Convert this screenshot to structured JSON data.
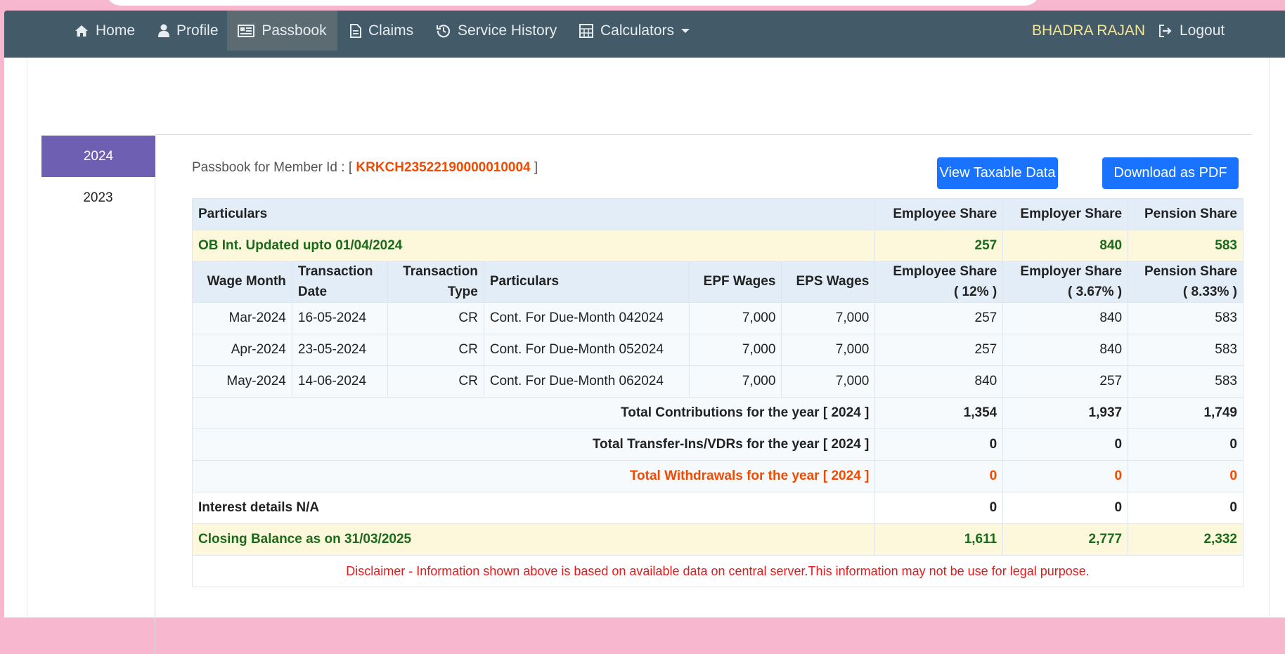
{
  "nav": {
    "home": "Home",
    "profile": "Profile",
    "passbook": "Passbook",
    "claims": "Claims",
    "service_history": "Service History",
    "calculators": "Calculators",
    "user": "BHADRA RAJAN",
    "logout": "Logout"
  },
  "years": [
    "2024",
    "2023"
  ],
  "passbook": {
    "prefix": "Passbook for Member Id : [",
    "member_id": "KRKCH23522190000010004",
    "suffix": "]"
  },
  "buttons": {
    "view_taxable": "View Taxable Data",
    "download_pdf": "Download as PDF"
  },
  "table": {
    "header": {
      "particulars": "Particulars",
      "employee_share": "Employee Share",
      "employer_share": "Employer Share",
      "pension_share": "Pension Share"
    },
    "ob": {
      "label": "OB Int. Updated upto 01/04/2024",
      "employee": "257",
      "employer": "840",
      "pension": "583"
    },
    "columns": {
      "wage_month": "Wage Month",
      "transaction_date": "Transaction Date",
      "transaction_type": "Transaction Type",
      "particulars": "Particulars",
      "epf_wages": "EPF Wages",
      "eps_wages": "EPS Wages",
      "employee_share": "Employee Share",
      "employee_pct": "( 12% )",
      "employer_share": "Employer Share",
      "employer_pct": "( 3.67% )",
      "pension_share": "Pension Share",
      "pension_pct": "( 8.33% )"
    },
    "rows": [
      {
        "wage_month": "Mar-2024",
        "date": "16-05-2024",
        "type": "CR",
        "particulars": "Cont. For Due-Month 042024",
        "epf": "7,000",
        "eps": "7,000",
        "employee": "257",
        "employer": "840",
        "pension": "583"
      },
      {
        "wage_month": "Apr-2024",
        "date": "23-05-2024",
        "type": "CR",
        "particulars": "Cont. For Due-Month 052024",
        "epf": "7,000",
        "eps": "7,000",
        "employee": "257",
        "employer": "840",
        "pension": "583"
      },
      {
        "wage_month": "May-2024",
        "date": "14-06-2024",
        "type": "CR",
        "particulars": "Cont. For Due-Month 062024",
        "epf": "7,000",
        "eps": "7,000",
        "employee": "840",
        "employer": "257",
        "pension": "583"
      }
    ],
    "totals": [
      {
        "label": "Total Contributions for the year [ 2024 ]",
        "employee": "1,354",
        "employer": "1,937",
        "pension": "1,749"
      },
      {
        "label": "Total Transfer-Ins/VDRs for the year [ 2024 ]",
        "employee": "0",
        "employer": "0",
        "pension": "0"
      },
      {
        "label": "Total Withdrawals for the year [ 2024 ]",
        "employee": "0",
        "employer": "0",
        "pension": "0"
      }
    ],
    "interest": {
      "label": "Interest details N/A",
      "employee": "0",
      "employer": "0",
      "pension": "0"
    },
    "closing": {
      "label": "Closing Balance as on 31/03/2025",
      "employee": "1,611",
      "employer": "2,777",
      "pension": "2,332"
    },
    "disclaimer": "Disclaimer - Information shown above is based on available data on central server.This information may not be use for legal purpose."
  }
}
